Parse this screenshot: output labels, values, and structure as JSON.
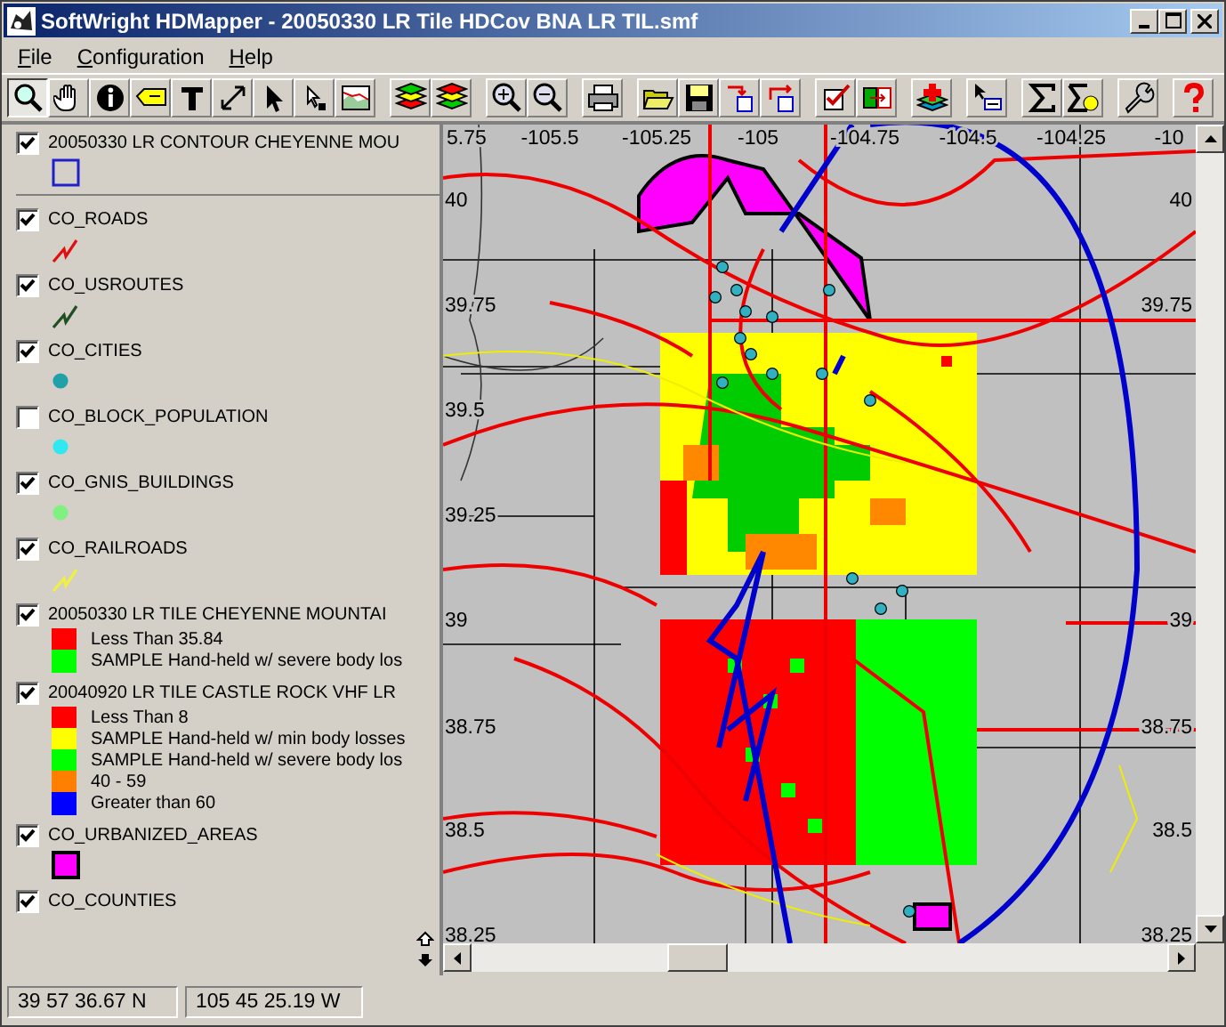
{
  "window": {
    "title": "SoftWright HDMapper - 20050330 LR Tile HDCov BNA LR TIL.smf"
  },
  "menu": [
    "File",
    "Configuration",
    "Help"
  ],
  "toolbar": {
    "tools": [
      {
        "kind": "zoom",
        "selected": true
      },
      {
        "kind": "hand",
        "selected": false
      },
      {
        "kind": "info",
        "selected": false
      },
      {
        "kind": "label",
        "selected": false
      },
      {
        "kind": "text",
        "selected": false
      },
      {
        "kind": "resize",
        "selected": false
      },
      {
        "kind": "pointer",
        "selected": false
      },
      {
        "kind": "node",
        "selected": false
      },
      {
        "kind": "profile",
        "selected": false
      },
      {
        "kind": "layers-red",
        "selected": false
      },
      {
        "kind": "layers-green",
        "selected": false
      },
      {
        "kind": "zoom-in",
        "selected": false
      },
      {
        "kind": "zoom-out",
        "selected": false
      },
      {
        "kind": "print",
        "selected": false
      },
      {
        "kind": "open",
        "selected": false
      },
      {
        "kind": "save",
        "selected": false
      },
      {
        "kind": "export-down",
        "selected": false
      },
      {
        "kind": "export-up",
        "selected": false
      },
      {
        "kind": "check",
        "selected": false
      },
      {
        "kind": "swap",
        "selected": false
      },
      {
        "kind": "add-layer",
        "selected": false
      },
      {
        "kind": "select-box",
        "selected": false
      },
      {
        "kind": "sigma",
        "selected": false
      },
      {
        "kind": "sigma-face",
        "selected": false
      },
      {
        "kind": "wrench",
        "selected": false
      },
      {
        "kind": "help",
        "selected": false
      }
    ]
  },
  "legend": {
    "layers": [
      {
        "name": "20050330 LR CONTOUR CHEYENNE MOU",
        "checked": true,
        "symbol": {
          "kind": "outline",
          "color": "#2020c8"
        }
      },
      {
        "name": "CO_ROADS",
        "checked": true,
        "symbol": {
          "kind": "line",
          "color": "#e01010"
        }
      },
      {
        "name": "CO_USROUTES",
        "checked": true,
        "symbol": {
          "kind": "line",
          "color": "#205020"
        }
      },
      {
        "name": "CO_CITIES",
        "checked": true,
        "symbol": {
          "kind": "dot",
          "color": "#20a0a8"
        }
      },
      {
        "name": "CO_BLOCK_POPULATION",
        "checked": false,
        "symbol": {
          "kind": "dot",
          "color": "#30e8f0"
        }
      },
      {
        "name": "CO_GNIS_BUILDINGS",
        "checked": true,
        "symbol": {
          "kind": "dot",
          "color": "#80f080"
        }
      },
      {
        "name": "CO_RAILROADS",
        "checked": true,
        "symbol": {
          "kind": "line",
          "color": "#f0f040"
        }
      },
      {
        "name": "20050330 LR TILE CHEYENNE MOUNTAI",
        "checked": true,
        "classes": [
          {
            "label": "Less Than 35.84",
            "color": "#ff0000"
          },
          {
            "label": "SAMPLE Hand-held w/ severe body los",
            "color": "#00ff00"
          }
        ]
      },
      {
        "name": "20040920 LR TILE CASTLE ROCK VHF LR",
        "checked": true,
        "classes": [
          {
            "label": "Less Than 8",
            "color": "#ff0000"
          },
          {
            "label": "SAMPLE Hand-held w/ min body losses",
            "color": "#ffff00"
          },
          {
            "label": "SAMPLE Hand-held w/ severe body los",
            "color": "#00ff00"
          },
          {
            "label": "40 - 59",
            "color": "#ff8000"
          },
          {
            "label": "Greater than 60",
            "color": "#0000ff"
          }
        ]
      },
      {
        "name": "CO_URBANIZED_AREAS",
        "checked": true,
        "symbol": {
          "kind": "fill",
          "color": "#ff00ff"
        }
      },
      {
        "name": "CO_COUNTIES",
        "checked": true
      }
    ]
  },
  "map": {
    "x_labels": [
      "5.75",
      "-105.5",
      "-105.25",
      "-105",
      "-104.75",
      "-104.5",
      "-104.25",
      "-10"
    ],
    "left_labels": [
      "40",
      "39.75",
      "39.5",
      "39.25",
      "39",
      "38.75",
      "38.5",
      "38.25"
    ],
    "right_labels": [
      "40",
      "39.75",
      "39",
      "38.75",
      "38.5",
      "38.25"
    ]
  },
  "status_bar": [
    "39 57 36.67 N",
    "105 45 25.19 W"
  ]
}
